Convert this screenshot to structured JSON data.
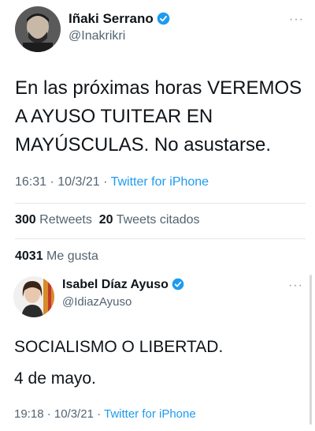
{
  "tweet1": {
    "name": "Iñaki Serrano",
    "handle": "@Inakrikri",
    "text": "En las próximas horas VEREMOS A AYUSO TUITEAR EN MAYÚSCULAS. No asustarse.",
    "time_date": "16:31 · 10/3/21 · ",
    "source": "Twitter for iPhone",
    "retweets_count": "300",
    "retweets_label": "Retweets",
    "quotes_count": "20",
    "quotes_label": "Tweets citados",
    "likes_count": "4031",
    "likes_label": "Me gusta"
  },
  "tweet2": {
    "name": "Isabel Díaz Ayuso",
    "handle": "@IdiazAyuso",
    "line1": "SOCIALISMO O LIBERTAD.",
    "line2": "4 de mayo.",
    "time_date": "19:18 · 10/3/21 · ",
    "source": "Twitter for iPhone"
  },
  "more_icon": "···",
  "colors": {
    "accent": "#1d9bf0",
    "secondary": "#536471"
  }
}
